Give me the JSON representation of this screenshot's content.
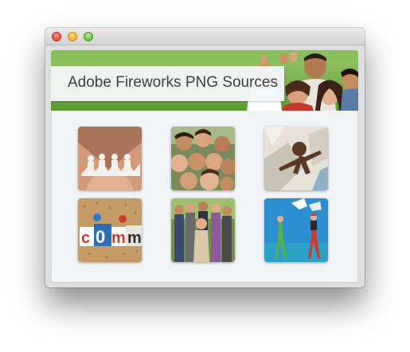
{
  "window": {
    "controls": [
      "close",
      "minimize",
      "zoom"
    ]
  },
  "banner": {
    "title": "Adobe Fireworks PNG Sources",
    "image": "group-of-students-photo"
  },
  "gallery": [
    {
      "image": "paper-chain-people-in-hands"
    },
    {
      "image": "group-of-smiling-friends"
    },
    {
      "image": "brown-paper-figure-on-cubes"
    },
    {
      "image": "comm-letters-on-corkboard"
    },
    {
      "image": "friends-posing-outdoors"
    },
    {
      "image": "illustrated-people-with-speech-bubbles"
    }
  ]
}
